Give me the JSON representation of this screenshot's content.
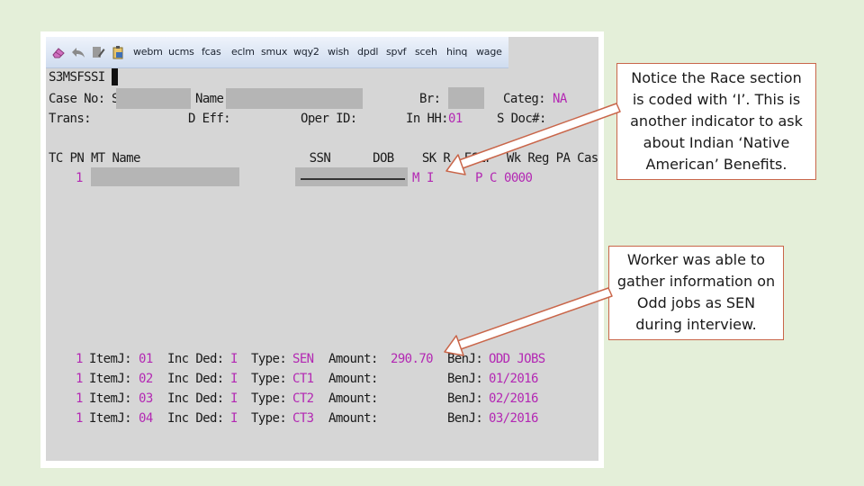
{
  "toolbar": {
    "buttons": [
      "webm",
      "ucms",
      "fcas",
      "eclm",
      "smux",
      "wqy2",
      "wish",
      "dpdl",
      "spvf",
      "sceh",
      "hinq",
      "wage"
    ],
    "icons": [
      "eraser-icon",
      "back-arrow-icon",
      "edit-icon",
      "clipboard-icon"
    ]
  },
  "screen": {
    "screen_id": "S3MSFSSI",
    "header": {
      "case_no_label": "Case No:",
      "case_no_prefix": "S",
      "name_label": "Name",
      "br_label": "Br:",
      "categ_label": "Categ:",
      "categ_value": "NA",
      "trans_label": "Trans:",
      "d_eff_label": "D Eff:",
      "oper_id_label": "Oper ID:",
      "inhh_label": "In HH:",
      "inhh_value": "01",
      "s_doc_label": "S Doc#:"
    },
    "member_table": {
      "header": "TC PN MT Name                        SSN      DOB    SK R  ESEF  Wk Reg PA Case",
      "row": {
        "pn": "1",
        "sk": "M",
        "race": "I",
        "col_p": "P",
        "col_c": "C",
        "case": "0000"
      }
    },
    "items": [
      {
        "pn": "1",
        "item_label": "ItemJ:",
        "item": "01",
        "inc_ded_label": "Inc Ded:",
        "inc_ded": "I",
        "type_label": "Type:",
        "type": "SEN",
        "amount_label": "Amount:",
        "amount": "290.70",
        "benj_label": "BenJ:",
        "benj": "ODD JOBS"
      },
      {
        "pn": "1",
        "item_label": "ItemJ:",
        "item": "02",
        "inc_ded_label": "Inc Ded:",
        "inc_ded": "I",
        "type_label": "Type:",
        "type": "CT1",
        "amount_label": "Amount:",
        "amount": "",
        "benj_label": "BenJ:",
        "benj": "01/2016"
      },
      {
        "pn": "1",
        "item_label": "ItemJ:",
        "item": "03",
        "inc_ded_label": "Inc Ded:",
        "inc_ded": "I",
        "type_label": "Type:",
        "type": "CT2",
        "amount_label": "Amount:",
        "amount": "",
        "benj_label": "BenJ:",
        "benj": "02/2016"
      },
      {
        "pn": "1",
        "item_label": "ItemJ:",
        "item": "04",
        "inc_ded_label": "Inc Ded:",
        "inc_ded": "I",
        "type_label": "Type:",
        "type": "CT3",
        "amount_label": "Amount:",
        "amount": "",
        "benj_label": "BenJ:",
        "benj": "03/2016"
      }
    ]
  },
  "callouts": {
    "race": "Notice the Race section is coded with ‘I’.  This is another indicator to ask about Indian ‘Native American’ Benefits.",
    "odd_jobs": "Worker was able to gather information on Odd jobs as SEN during interview."
  },
  "colors": {
    "background": "#e4efd9",
    "screen": "#d6d6d6",
    "magenta_text": "#b328b3",
    "callout_border": "#c9664a",
    "redaction": "#b5b5b5"
  }
}
